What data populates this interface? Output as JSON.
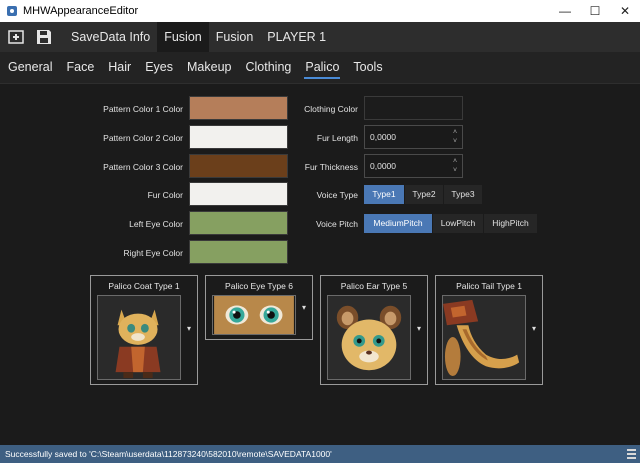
{
  "window": {
    "title": "MHWAppearanceEditor",
    "minimize": "—",
    "maximize": "☐",
    "close": "✕"
  },
  "toolbar": {
    "tabs": [
      {
        "label": "SaveData Info"
      },
      {
        "label": "Fusion"
      },
      {
        "label": "Fusion"
      },
      {
        "label": "PLAYER 1"
      }
    ]
  },
  "subtabs": [
    "General",
    "Face",
    "Hair",
    "Eyes",
    "Makeup",
    "Clothing",
    "Palico",
    "Tools"
  ],
  "palico": {
    "left": [
      {
        "label": "Pattern Color 1 Color",
        "color": "#b57e5a"
      },
      {
        "label": "Pattern Color 2 Color",
        "color": "#f2f1ee"
      },
      {
        "label": "Pattern Color 3 Color",
        "color": "#6b3f1b"
      },
      {
        "label": "Fur Color",
        "color": "#f2f1ee"
      },
      {
        "label": "Left Eye Color",
        "color": "#86a061"
      },
      {
        "label": "Right Eye Color",
        "color": "#86a061"
      }
    ],
    "clothing_color": {
      "label": "Clothing Color",
      "color": "#1c1c1c"
    },
    "fur_length": {
      "label": "Fur Length",
      "value": "0,0000"
    },
    "fur_thickness": {
      "label": "Fur Thickness",
      "value": "0,0000"
    },
    "voice_type": {
      "label": "Voice Type",
      "options": [
        "Type1",
        "Type2",
        "Type3"
      ],
      "selected": 0
    },
    "voice_pitch": {
      "label": "Voice Pitch",
      "options": [
        "MediumPitch",
        "LowPitch",
        "HighPitch"
      ],
      "selected": 0
    }
  },
  "parts": [
    {
      "title": "Palico Coat Type 1",
      "icon": "palico-coat-icon"
    },
    {
      "title": "Palico Eye Type 6",
      "icon": "palico-eye-icon"
    },
    {
      "title": "Palico Ear Type 5",
      "icon": "palico-ear-icon"
    },
    {
      "title": "Palico Tail Type 1",
      "icon": "palico-tail-icon"
    }
  ],
  "dropdown_glyph": "▾",
  "spin_up": "˄",
  "spin_down": "˅",
  "status": "Successfully saved to 'C:\\Steam\\userdata\\112873240\\582010\\remote\\SAVEDATA1000'"
}
